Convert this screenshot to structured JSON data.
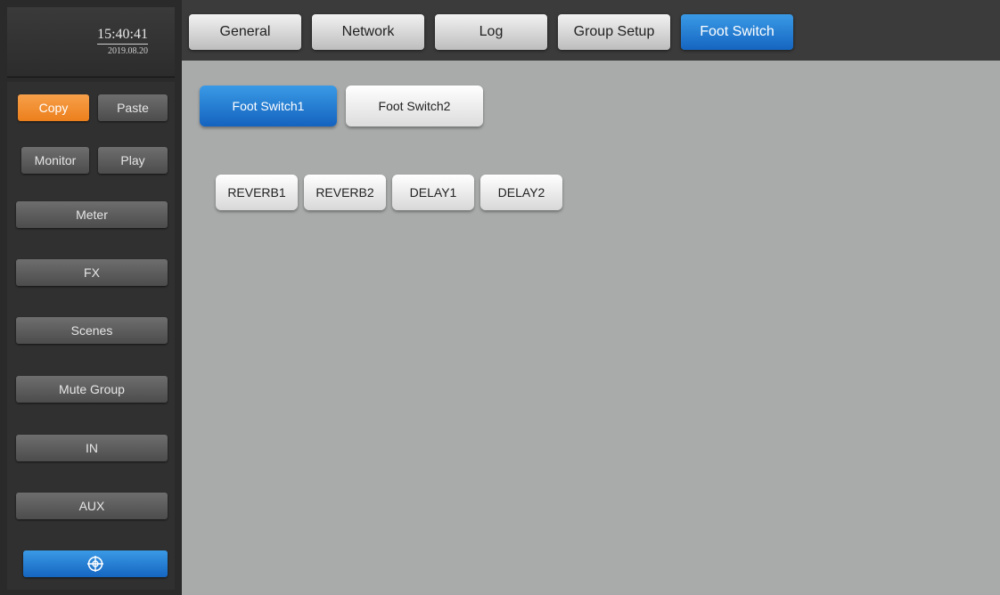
{
  "clock": {
    "time": "15:40:41",
    "date": "2019.08.20"
  },
  "sidebar": {
    "copy_label": "Copy",
    "paste_label": "Paste",
    "monitor_label": "Monitor",
    "play_label": "Play",
    "items": [
      {
        "label": "Meter"
      },
      {
        "label": "FX"
      },
      {
        "label": "Scenes"
      },
      {
        "label": "Mute Group"
      },
      {
        "label": "IN"
      },
      {
        "label": "AUX"
      }
    ],
    "bottom_icon": "target-icon"
  },
  "tabs": [
    {
      "label": "General"
    },
    {
      "label": "Network"
    },
    {
      "label": "Log"
    },
    {
      "label": "Group Setup"
    },
    {
      "label": "Foot Switch",
      "active": true
    }
  ],
  "subtabs": [
    {
      "label": "Foot Switch1",
      "active": true
    },
    {
      "label": "Foot Switch2"
    }
  ],
  "fx_buttons": [
    {
      "label": "REVERB1"
    },
    {
      "label": "REVERB2"
    },
    {
      "label": "DELAY1"
    },
    {
      "label": "DELAY2"
    }
  ],
  "colors": {
    "accent_blue": "#1e7ad8",
    "accent_orange": "#f28a2a",
    "content_bg": "#a9abab",
    "sidebar_bg": "#2a2a2a"
  }
}
